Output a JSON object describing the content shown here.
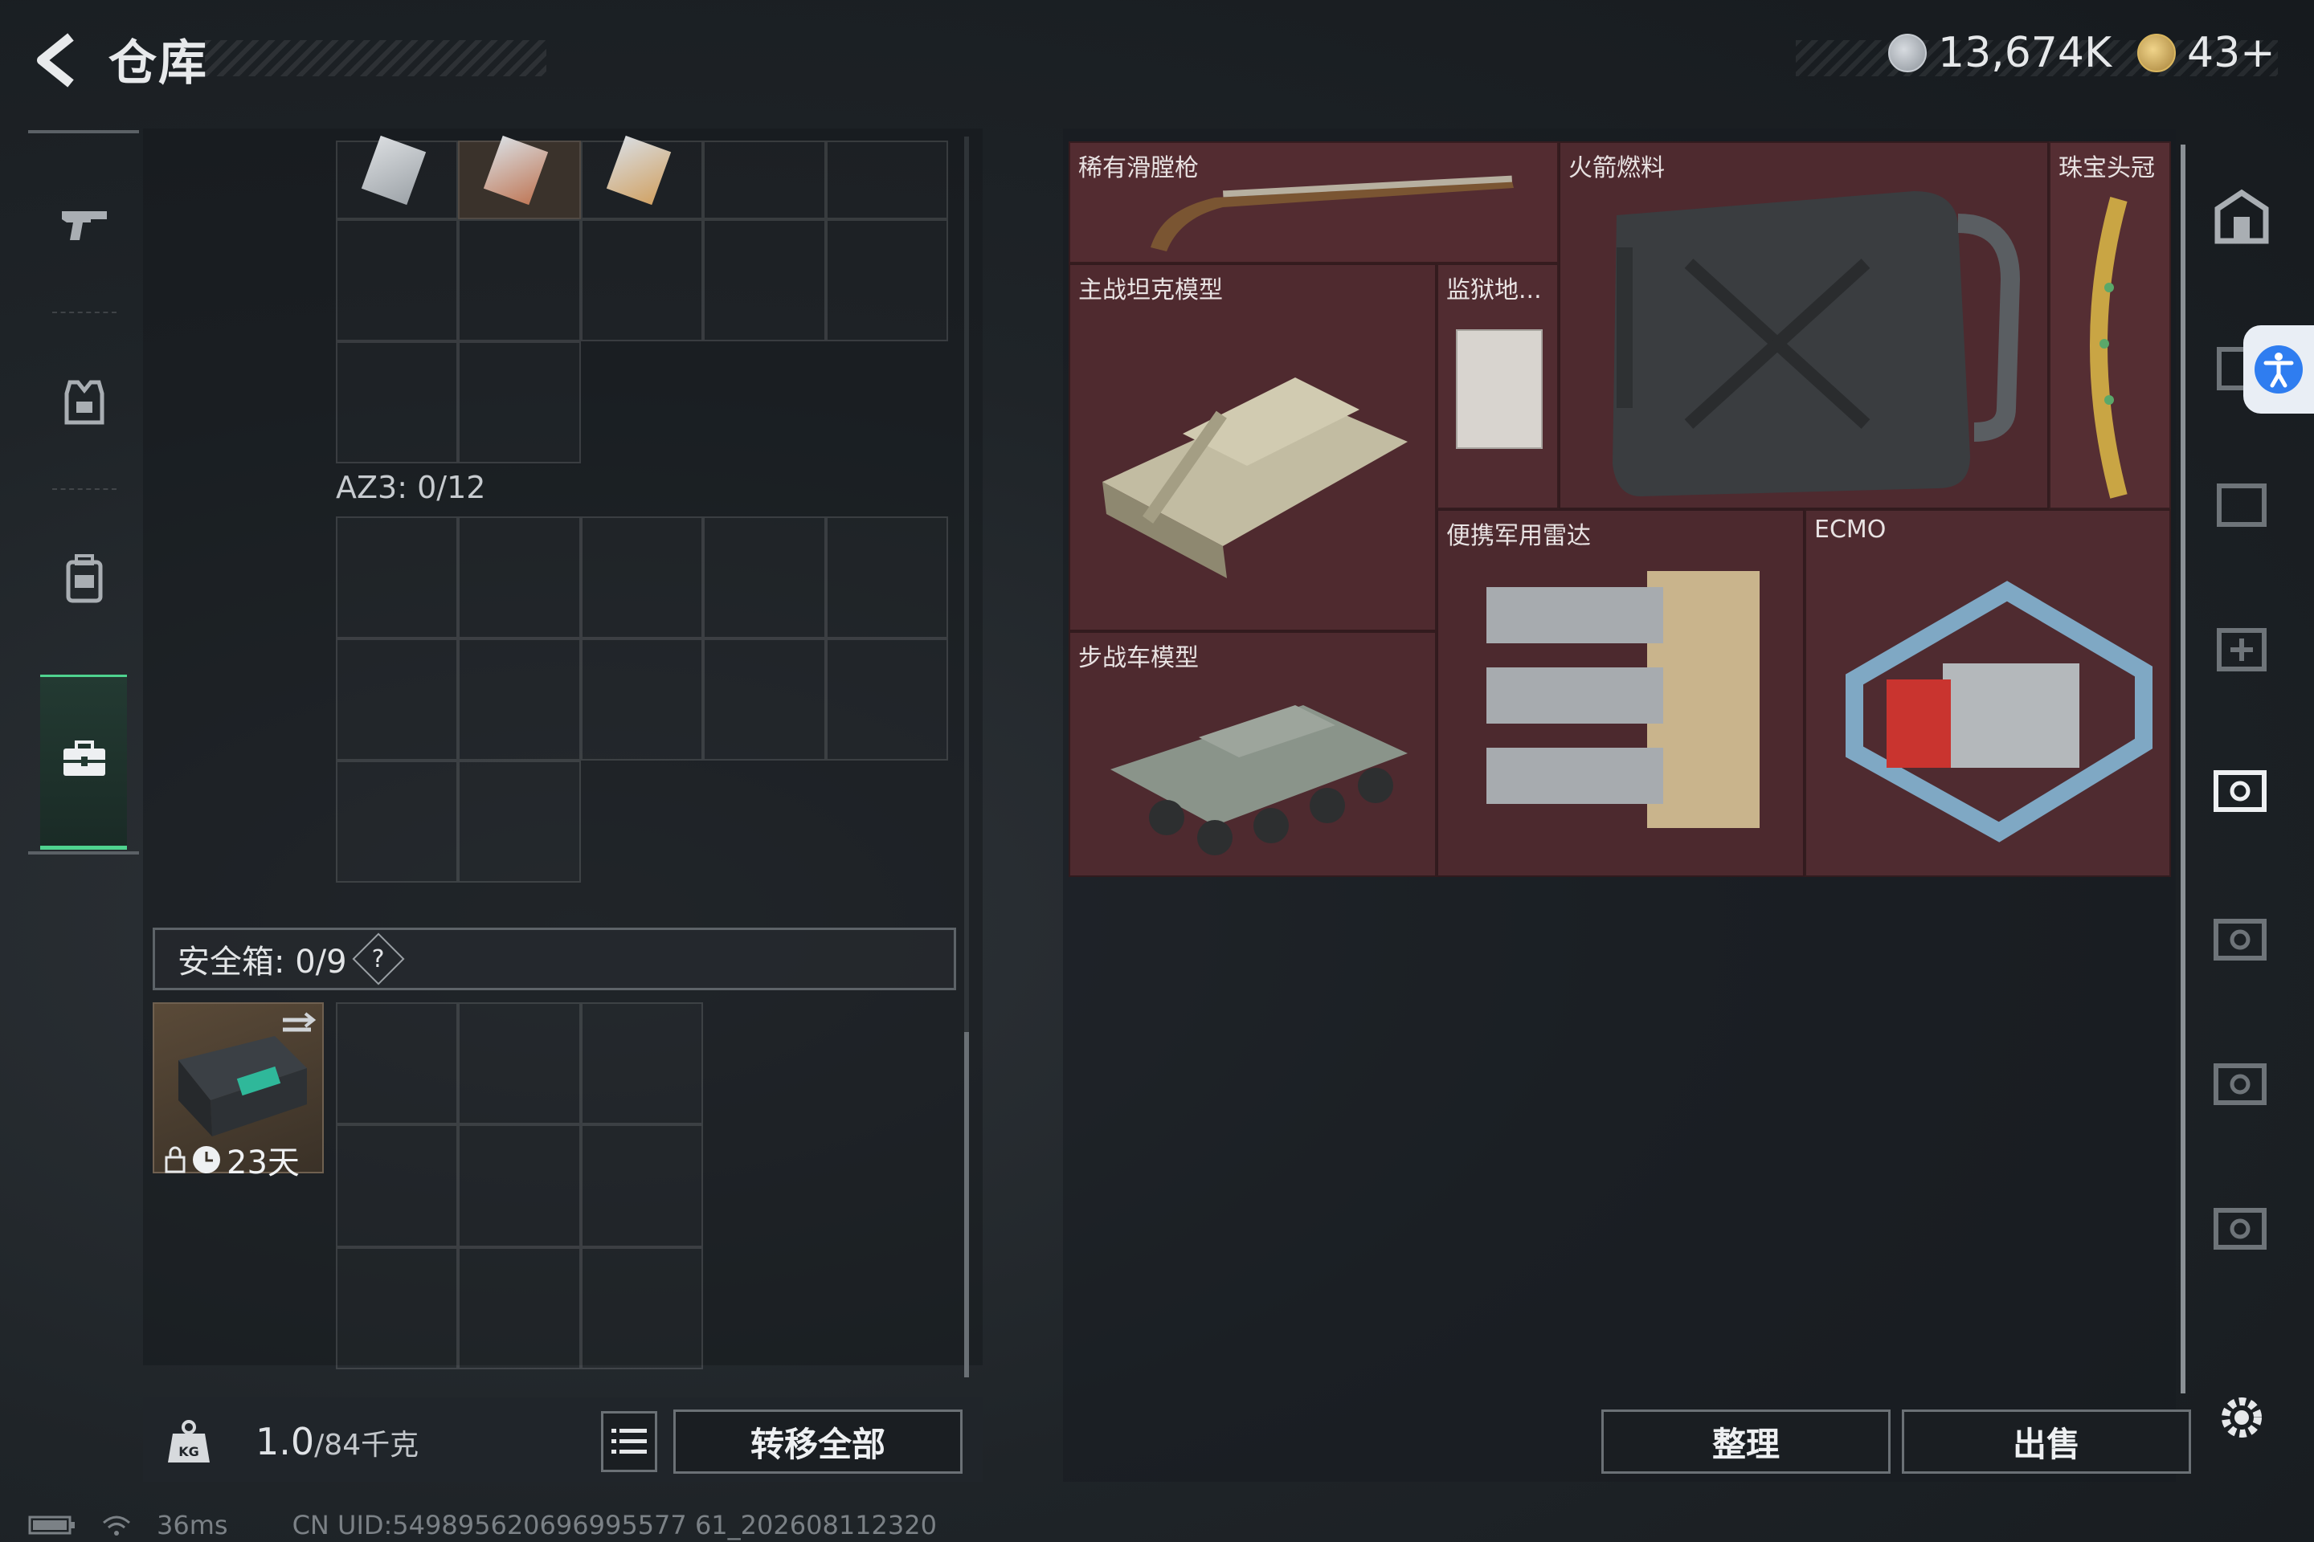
{
  "header": {
    "title": "仓库",
    "currency_1": "13,674K",
    "currency_2": "43+"
  },
  "sidebar": {
    "items": [
      {
        "name": "weapons",
        "icon": "gun-icon"
      },
      {
        "name": "armor",
        "icon": "vest-icon"
      },
      {
        "name": "backpack",
        "icon": "backpack-icon"
      },
      {
        "name": "safe-box",
        "icon": "briefcase-icon",
        "active": true
      }
    ]
  },
  "left_panel": {
    "section_label": "AZ3: 0/12",
    "safe_box_label": "安全箱: 0/9",
    "safe_box_help": "?",
    "safe_item_days": "23天",
    "weight_value": "1.0",
    "weight_capacity": "/84千克",
    "transfer_all": "转移全部"
  },
  "stash": {
    "items": [
      {
        "label": "稀有滑膛枪"
      },
      {
        "label": "火箭燃料"
      },
      {
        "label": "珠宝头冠"
      },
      {
        "label": "主战坦克模型"
      },
      {
        "label": "监狱地..."
      },
      {
        "label": "便携军用雷达"
      },
      {
        "label": "ECMO"
      },
      {
        "label": "步战车模型"
      }
    ],
    "organize": "整理",
    "sell": "出售"
  },
  "status": {
    "ping": "36ms",
    "uid": "CN UID:549895620696995577 61_202608112320"
  },
  "colors": {
    "accent": "#4fd38f",
    "stash_bg": "#4e2a2f"
  }
}
